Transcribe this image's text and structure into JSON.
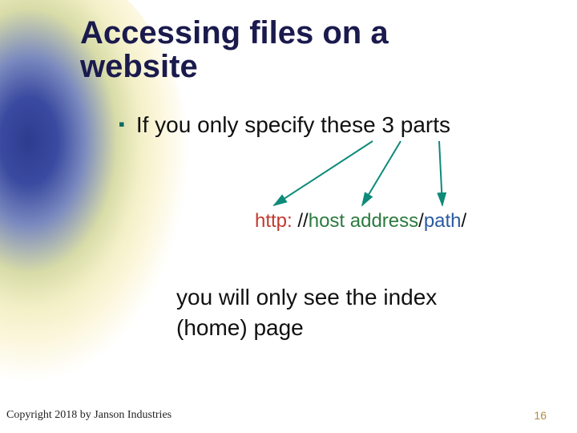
{
  "title_line1": "Accessing files on a",
  "title_line2": "website",
  "bullet": "If you only specify these 3 parts",
  "url": {
    "protocol": "http:",
    "sep1": " //",
    "host": "host address",
    "sep2": "/",
    "path": "path",
    "sep3": "/"
  },
  "body_line1": "you will only see the index",
  "body_line2": "(home) page",
  "copyright": "Copyright 2018 by Janson Industries",
  "page_number": "16"
}
